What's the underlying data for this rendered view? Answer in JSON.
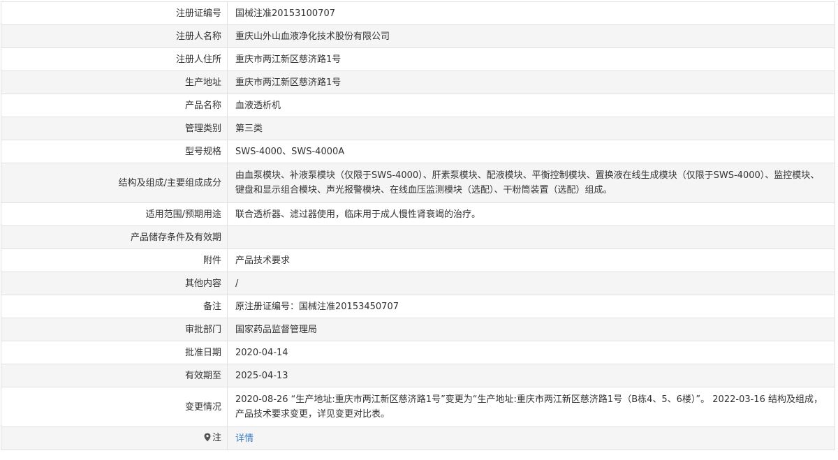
{
  "rows": [
    {
      "label": "注册证编号",
      "value": "国械注准20153100707"
    },
    {
      "label": "注册人名称",
      "value": "重庆山外山血液净化技术股份有限公司"
    },
    {
      "label": "注册人住所",
      "value": "重庆市两江新区慈济路1号"
    },
    {
      "label": "生产地址",
      "value": "重庆市两江新区慈济路1号"
    },
    {
      "label": "产品名称",
      "value": "血液透析机"
    },
    {
      "label": "管理类别",
      "value": "第三类"
    },
    {
      "label": "型号规格",
      "value": "SWS-4000、SWS-4000A"
    },
    {
      "label": "结构及组成/主要组成成分",
      "value": "由血泵模块、补液泵模块（仅限于SWS-4000）、肝素泵模块、配液模块、平衡控制模块、置换液在线生成模块（仅限于SWS-4000）、监控模块、键盘和显示组合模块、声光报警模块、在线血压监测模块（选配）、干粉筒装置（选配）组成。"
    },
    {
      "label": "适用范围/预期用途",
      "value": "联合透析器、滤过器使用，临床用于成人慢性肾衰竭的治疗。"
    },
    {
      "label": "产品储存条件及有效期",
      "value": ""
    },
    {
      "label": "附件",
      "value": "产品技术要求"
    },
    {
      "label": "其他内容",
      "value": "/"
    },
    {
      "label": "备注",
      "value": "原注册证编号：国械注准20153450707"
    },
    {
      "label": "审批部门",
      "value": "国家药品监督管理局"
    },
    {
      "label": "批准日期",
      "value": "2020-04-14"
    },
    {
      "label": "有效期至",
      "value": "2025-04-13"
    },
    {
      "label": "变更情况",
      "value": "2020-08-26 “生产地址:重庆市两江新区慈济路1号”变更为“生产地址:重庆市两江新区慈济路1号（B栋4、5、6楼）”。 2022-03-16 结构及组成，产品技术要求变更，详见变更对比表。"
    }
  ],
  "note": {
    "label": "注",
    "link": "详情",
    "icon": "map-pin-icon"
  },
  "colors": {
    "border": "#e1e1e1",
    "stripe": "#f5f5f5",
    "link": "#3b80c4",
    "text": "#333333"
  }
}
